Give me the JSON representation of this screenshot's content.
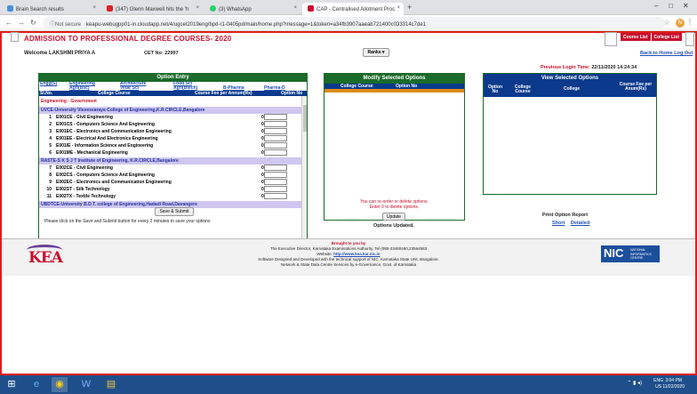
{
  "browser": {
    "tabs": [
      {
        "label": "Brain Search results",
        "color": "#4a90d9"
      },
      {
        "label": "(347) Glenn Maxwell hits the 'h",
        "color": "#e02020"
      },
      {
        "label": "(3) WhatsApp",
        "color": "#25d366"
      },
      {
        "label": "CAP - Centralised Allotment Proc",
        "color": "#c8102e"
      }
    ],
    "new_tab": "+",
    "not_secure": "Not secure",
    "url": "keapu-webugpp01-in.cloudapp.net/4/ugcet2019eng/bpd-r1-0405pd/main/home.php?message=1&token=a34fb3907aaeab721400c033314c7de1",
    "profile_initial": "N"
  },
  "header": {
    "title": "ADMISSION TO PROFESSIONAL DEGREE COURSES- 2020",
    "course_list": "Course List",
    "college_list": "College List",
    "welcome": "Welcome LAKSHMI PRIYA A",
    "cet_no": "CET No: 22997",
    "ranks_button": "Ranks",
    "back_home": "Back to Home",
    "logout": "Log Out",
    "last_login_label": "Previous Login Time:",
    "last_login_value": "22/11/2020 14:24:34"
  },
  "entry": {
    "title": "Option Entry",
    "categories": [
      "Engg(S)",
      "Engineering Agri(Bsc)",
      "Architecture Vetar Sci",
      "Food Sci Agri(Btech)",
      "B-Pharma",
      "Pharma-D"
    ],
    "col_sl": "Sl.No.",
    "col_course": "College Course",
    "col_fee": "Course Fee per Annum(Rs)",
    "col_option": "Option No",
    "group": "Engineering - Government",
    "college1": "UVCE-University Visvesvaraya College of Engineering,K.R.CIRCLE,Bangalore",
    "college2": "RASTE-S K S J T Institute of Engineering, K.R.CIRCLE,Bangalore",
    "college3": "UBDTCE-University B.D.T. college of Engineering,Hadadi Road,Davangere",
    "courses": [
      {
        "sl": "1",
        "name": "E001CE - Civil Engineering",
        "fee": "0"
      },
      {
        "sl": "2",
        "name": "E001CS - Computers Science And Engineering",
        "fee": "0"
      },
      {
        "sl": "3",
        "name": "E001EC - Electronics and Communication Engineering",
        "fee": "0"
      },
      {
        "sl": "4",
        "name": "E001EE - Electrical And Electronics Engineering",
        "fee": "0"
      },
      {
        "sl": "5",
        "name": "E001IE - Information Science and Engineering",
        "fee": "0"
      },
      {
        "sl": "6",
        "name": "E001ME - Mechanical Engineering",
        "fee": "0"
      },
      {
        "sl": "7",
        "name": "E002CE - Civil Engineering",
        "fee": "0"
      },
      {
        "sl": "8",
        "name": "E002CS - Computers Science And Engineering",
        "fee": "0"
      },
      {
        "sl": "9",
        "name": "E002EC - Electronics and Communication Engineering",
        "fee": "0"
      },
      {
        "sl": "10",
        "name": "E002ST - Silk Technology",
        "fee": "0"
      },
      {
        "sl": "11",
        "name": "E002TX - Textile Technology",
        "fee": "0"
      }
    ],
    "save_button": "Save & Submit",
    "save_note": "Please click on the Save and Submit button for every 2 minutes to save your options"
  },
  "modify": {
    "title": "Modify Selected Options",
    "col_course": "College Course",
    "col_option": "Option No",
    "note1": "You can re-order or delete options.",
    "note2": "Enter 0 to delete options.",
    "update_button": "Update",
    "updated": "Options Updated."
  },
  "view": {
    "title": "View Selected Options",
    "col_option": "Option No",
    "col_course": "College Course",
    "col_college": "College",
    "col_fee": "Course Fee per Anum(Rs)",
    "print_title": "Print Option Report",
    "short": "Short",
    "detailed": "Detailed"
  },
  "footer": {
    "brought": "Brought to you by",
    "line1": "The Executive Director, Karnataka Examinations Authority, Tel (080-23460460,23564583",
    "website_label": "Website:",
    "website": "http://www.kea.kar.nic.in",
    "line3": "Software Designed and Developed with the technical support of NIC, Karnataka State Unit, Bangalore.",
    "line4": "Network & State Data Centre Services by e-Governance, Govt. of Karnataka",
    "kea_logo": "KEA",
    "nic_logo": "NIC",
    "nic_sub": "NATIONAL INFORMATICS CENTRE"
  },
  "taskbar": {
    "lang": "ENG",
    "lang2": "US",
    "time": "3:04 PM",
    "date": "11/22/2020"
  }
}
